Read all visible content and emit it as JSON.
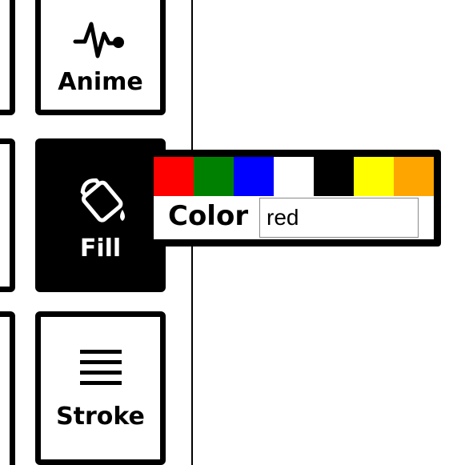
{
  "toolbar": {
    "tools": [
      {
        "label": "Anime",
        "icon": "pulse-icon",
        "active": false
      },
      {
        "label": "Fill",
        "icon": "paint-bucket-icon",
        "active": true
      },
      {
        "label": "Stroke",
        "icon": "lines-icon",
        "active": false
      }
    ]
  },
  "color_popup": {
    "swatches": [
      {
        "name": "red",
        "color": "#ff0000"
      },
      {
        "name": "green",
        "color": "#008000"
      },
      {
        "name": "blue",
        "color": "#0000ff"
      },
      {
        "name": "white",
        "color": "#ffffff"
      },
      {
        "name": "black",
        "color": "#000000"
      },
      {
        "name": "yellow",
        "color": "#ffff00"
      },
      {
        "name": "orange",
        "color": "#ffa500"
      }
    ],
    "label": "Color",
    "input_value": "red"
  }
}
